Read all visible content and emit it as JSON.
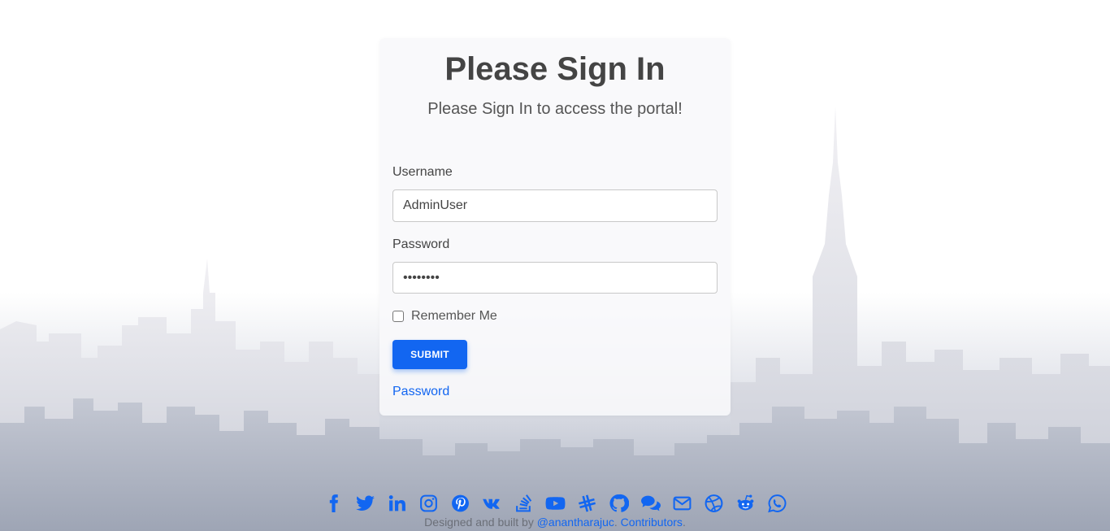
{
  "card": {
    "title": "Please Sign In",
    "subtitle": "Please Sign In to access the portal!"
  },
  "form": {
    "username_label": "Username",
    "username_value": "AdminUser",
    "password_label": "Password",
    "password_value": "••••••••",
    "remember_label": "Remember Me",
    "remember_checked": false,
    "submit_label": "SUBMIT",
    "password_link": "Password"
  },
  "social_icons": [
    "facebook-icon",
    "twitter-icon",
    "linkedin-icon",
    "instagram-icon",
    "pinterest-icon",
    "vk-icon",
    "stackoverflow-icon",
    "youtube-icon",
    "slack-icon",
    "github-icon",
    "chat-icon",
    "email-icon",
    "dribbble-icon",
    "reddit-icon",
    "whatsapp-icon"
  ],
  "footer": {
    "prefix": "Designed and built by ",
    "author": "@anantharajuc",
    "separator": ". ",
    "contributors": "Contributors",
    "suffix": "."
  },
  "colors": {
    "accent": "#1266f1",
    "text": "#444444"
  }
}
